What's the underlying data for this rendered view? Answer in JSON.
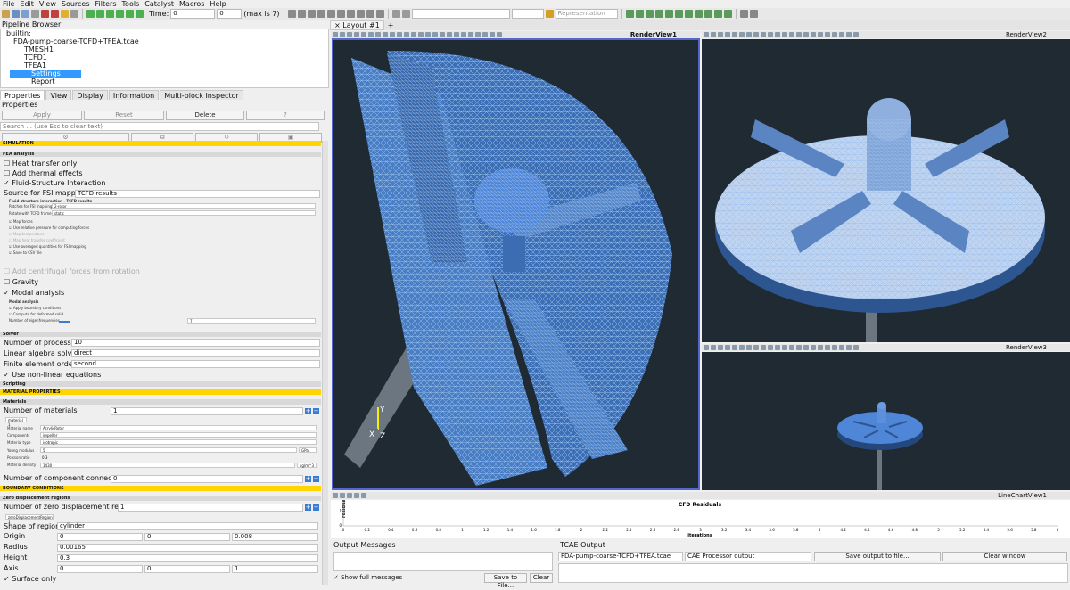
{
  "menu": [
    "File",
    "Edit",
    "View",
    "Sources",
    "Filters",
    "Tools",
    "Catalyst",
    "Macros",
    "Help"
  ],
  "toolbar": {
    "time_label": "Time:",
    "time_value": "0",
    "step_value": "0",
    "max_label": "(max is 7)",
    "representation": "Representation"
  },
  "pipeline": {
    "title": "Pipeline Browser",
    "items": [
      "builtin:",
      "FDA-pump-coarse-TCFD+TFEA.tcae",
      "TMESH1",
      "TCFD1",
      "TFEA1",
      "Settings",
      "Report"
    ]
  },
  "tabs": [
    "Properties",
    "View",
    "Display",
    "Information",
    "Multi-block Inspector"
  ],
  "properties": {
    "title": "Properties",
    "apply": "Apply",
    "reset": "Reset",
    "delete": "Delete",
    "help": "?",
    "search_placeholder": "Search ... (use Esc to clear text)"
  },
  "form": {
    "simulation": "SIMULATION",
    "fea": "FEA analysis",
    "heat": "Heat transfer only",
    "thermal": "Add thermal effects",
    "fsi": "Fluid-Structure Interaction",
    "source_label": "Source for FSI mapping",
    "source_value": "TCFD results",
    "fsi_group": "Fluid-structure interaction - TCFD results",
    "patches_label": "Patches for FSI mapping",
    "patches_value": "2-rotor",
    "rotate_label": "Rotate with TCFD frame",
    "rotate_value": "static",
    "map_forces": "Map forces",
    "rel_pressure": "Use relative pressure for computing forces",
    "map_temp": "Map temperature",
    "map_htc": "Map heat transfer coefficient",
    "avg": "Use averaged quantities for FSI mapping",
    "csv": "Save to CSV file",
    "centrifugal": "Add centrifugal forces from rotation",
    "gravity": "Gravity",
    "modal": "Modal analysis",
    "modal_group": "Modal analysis",
    "apply_bc": "Apply boundary conditions",
    "deformed": "Compute for deformed solid",
    "eigen_label": "Number of eigenfrequencies",
    "eigen_value": "7",
    "solver": "Solver",
    "nproc_label": "Number of processors",
    "nproc_value": "10",
    "linsolver_label": "Linear algebra solver",
    "linsolver_value": "direct",
    "order_label": "Finite element order",
    "order_value": "second",
    "nonlinear": "Use non-linear equations",
    "scripting": "Scripting",
    "material_props": "MATERIAL PROPERTIES",
    "materials": "Materials",
    "nmat_label": "Number of materials",
    "nmat_value": "1",
    "mat_tab": "material 1",
    "mat_name_label": "Material name",
    "mat_name_value": "AcrylicRotor",
    "comp_label": "Components",
    "comp_value": "impeller",
    "type_label": "Material type",
    "type_value": "isotropic",
    "young_label": "Young modulus",
    "young_value": "5",
    "young_unit": "GPa",
    "poisson_label": "Poisson ratio",
    "poisson_value": "0.3",
    "density_label": "Material density",
    "density_value": "1430",
    "density_unit": "kg/m^3",
    "ncomp_label": "Number of component connections",
    "ncomp_value": "0",
    "bc": "BOUNDARY CONDITIONS",
    "zero_disp": "Zero displacement regions",
    "nzero_label": "Number of zero displacement regions",
    "nzero_value": "1",
    "zero_tab": "zeroDisplacementRegion 1",
    "shape_label": "Shape of region",
    "shape_value": "cylinder",
    "origin_label": "Origin",
    "origin_values": [
      "0",
      "0",
      "0.008"
    ],
    "radius_label": "Radius",
    "radius_value": "0.00165",
    "height_label": "Height",
    "height_value": "0.3",
    "axis_label": "Axis",
    "axis_values": [
      "0",
      "0",
      "1"
    ],
    "surface": "Surface only"
  },
  "layout": {
    "tab": "Layout #1",
    "views": [
      "RenderView1",
      "RenderView2",
      "RenderView3",
      "LineChartView1"
    ]
  },
  "chart_data": {
    "type": "line",
    "title": "CFD Residuals",
    "xlabel": "iterations",
    "ylabel": "residuals",
    "x_ticks": [
      "0",
      "0.2",
      "0.4",
      "0.6",
      "0.8",
      "1",
      "1.2",
      "1.4",
      "1.6",
      "1.8",
      "2",
      "2.2",
      "2.4",
      "2.6",
      "2.8",
      "3",
      "3.2",
      "3.4",
      "3.6",
      "3.8",
      "4",
      "4.2",
      "4.4",
      "4.6",
      "4.8",
      "5",
      "5.2",
      "5.4",
      "5.6",
      "5.8",
      "6"
    ],
    "y_ticks": [
      "1",
      "0"
    ],
    "series": []
  },
  "output": {
    "title": "Output Messages",
    "show_full": "Show full messages",
    "save": "Save to File...",
    "clear": "Clear"
  },
  "tcae": {
    "title": "TCAE Output",
    "file": "FDA-pump-coarse-TCFD+TFEA.tcae",
    "processor": "CAE Processor output",
    "save": "Save output to file...",
    "clear": "Clear window"
  },
  "axes": {
    "y": "Y",
    "x": "X",
    "z": "Z"
  },
  "colors": {
    "accent": "#ffd400",
    "render_bg": "#1f2a33",
    "mesh": "#4f86d8",
    "select": "#3399ff"
  }
}
